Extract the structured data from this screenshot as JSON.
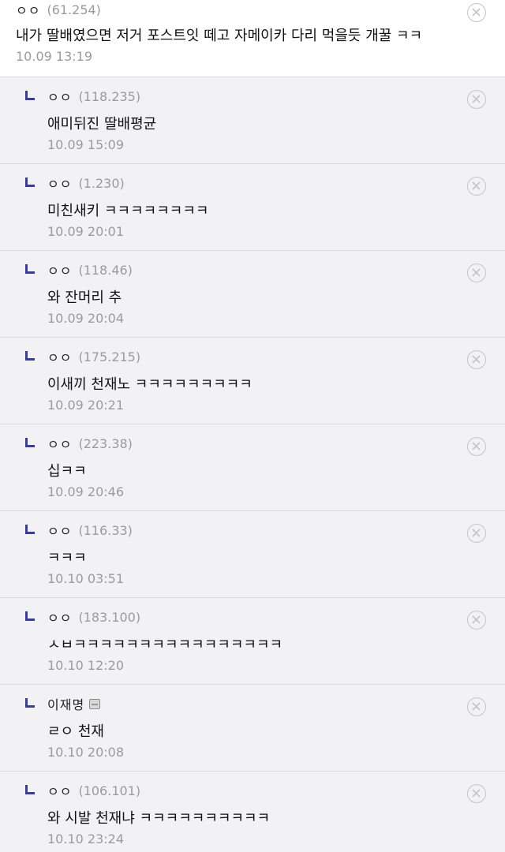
{
  "comments": [
    {
      "nick": "ㅇㅇ",
      "ip": "(61.254)",
      "text": "내가 딸배였으면 저거 포스트잇 떼고 자메이카 다리 먹을듯 개꿀 ㅋㅋ",
      "time": "10.09 13:19"
    },
    {
      "nick": "ㅇㅇ",
      "ip": "(118.235)",
      "text": "애미뒤진 딸배평균",
      "time": "10.09 15:09"
    },
    {
      "nick": "ㅇㅇ",
      "ip": "(1.230)",
      "text": "미친새키 ㅋㅋㅋㅋㅋㅋㅋㅋ",
      "time": "10.09 20:01"
    },
    {
      "nick": "ㅇㅇ",
      "ip": "(118.46)",
      "text": "와 잔머리 추",
      "time": "10.09 20:04"
    },
    {
      "nick": "ㅇㅇ",
      "ip": "(175.215)",
      "text": "이새끼 천재노 ㅋㅋㅋㅋㅋㅋㅋㅋㅋ",
      "time": "10.09 20:21"
    },
    {
      "nick": "ㅇㅇ",
      "ip": "(223.38)",
      "text": "십ㅋㅋ",
      "time": "10.09 20:46"
    },
    {
      "nick": "ㅇㅇ",
      "ip": "(116.33)",
      "text": "ㅋㅋㅋ",
      "time": "10.10 03:51"
    },
    {
      "nick": "ㅇㅇ",
      "ip": "(183.100)",
      "text": "ㅅㅂㅋㅋㅋㅋㅋㅋㅋㅋㅋㅋㅋㅋㅋㅋㅋㅋ",
      "time": "10.10 12:20"
    },
    {
      "nick": "이재명",
      "ip": "",
      "text": "ㄹㅇ 천재",
      "time": "10.10 20:08"
    },
    {
      "nick": "ㅇㅇ",
      "ip": "(106.101)",
      "text": "와 시발 천재냐 ㅋㅋㅋㅋㅋㅋㅋㅋㅋㅋ",
      "time": "10.10 23:24"
    }
  ],
  "icons": {
    "reply": "reply-arrow-icon",
    "delete": "close-circle-icon",
    "gallog": "gallog-badge-icon"
  },
  "colors": {
    "reply_background": "#f2f2f5",
    "reply_mark": "#3b3f86",
    "meta_text": "#9a9aa2"
  }
}
